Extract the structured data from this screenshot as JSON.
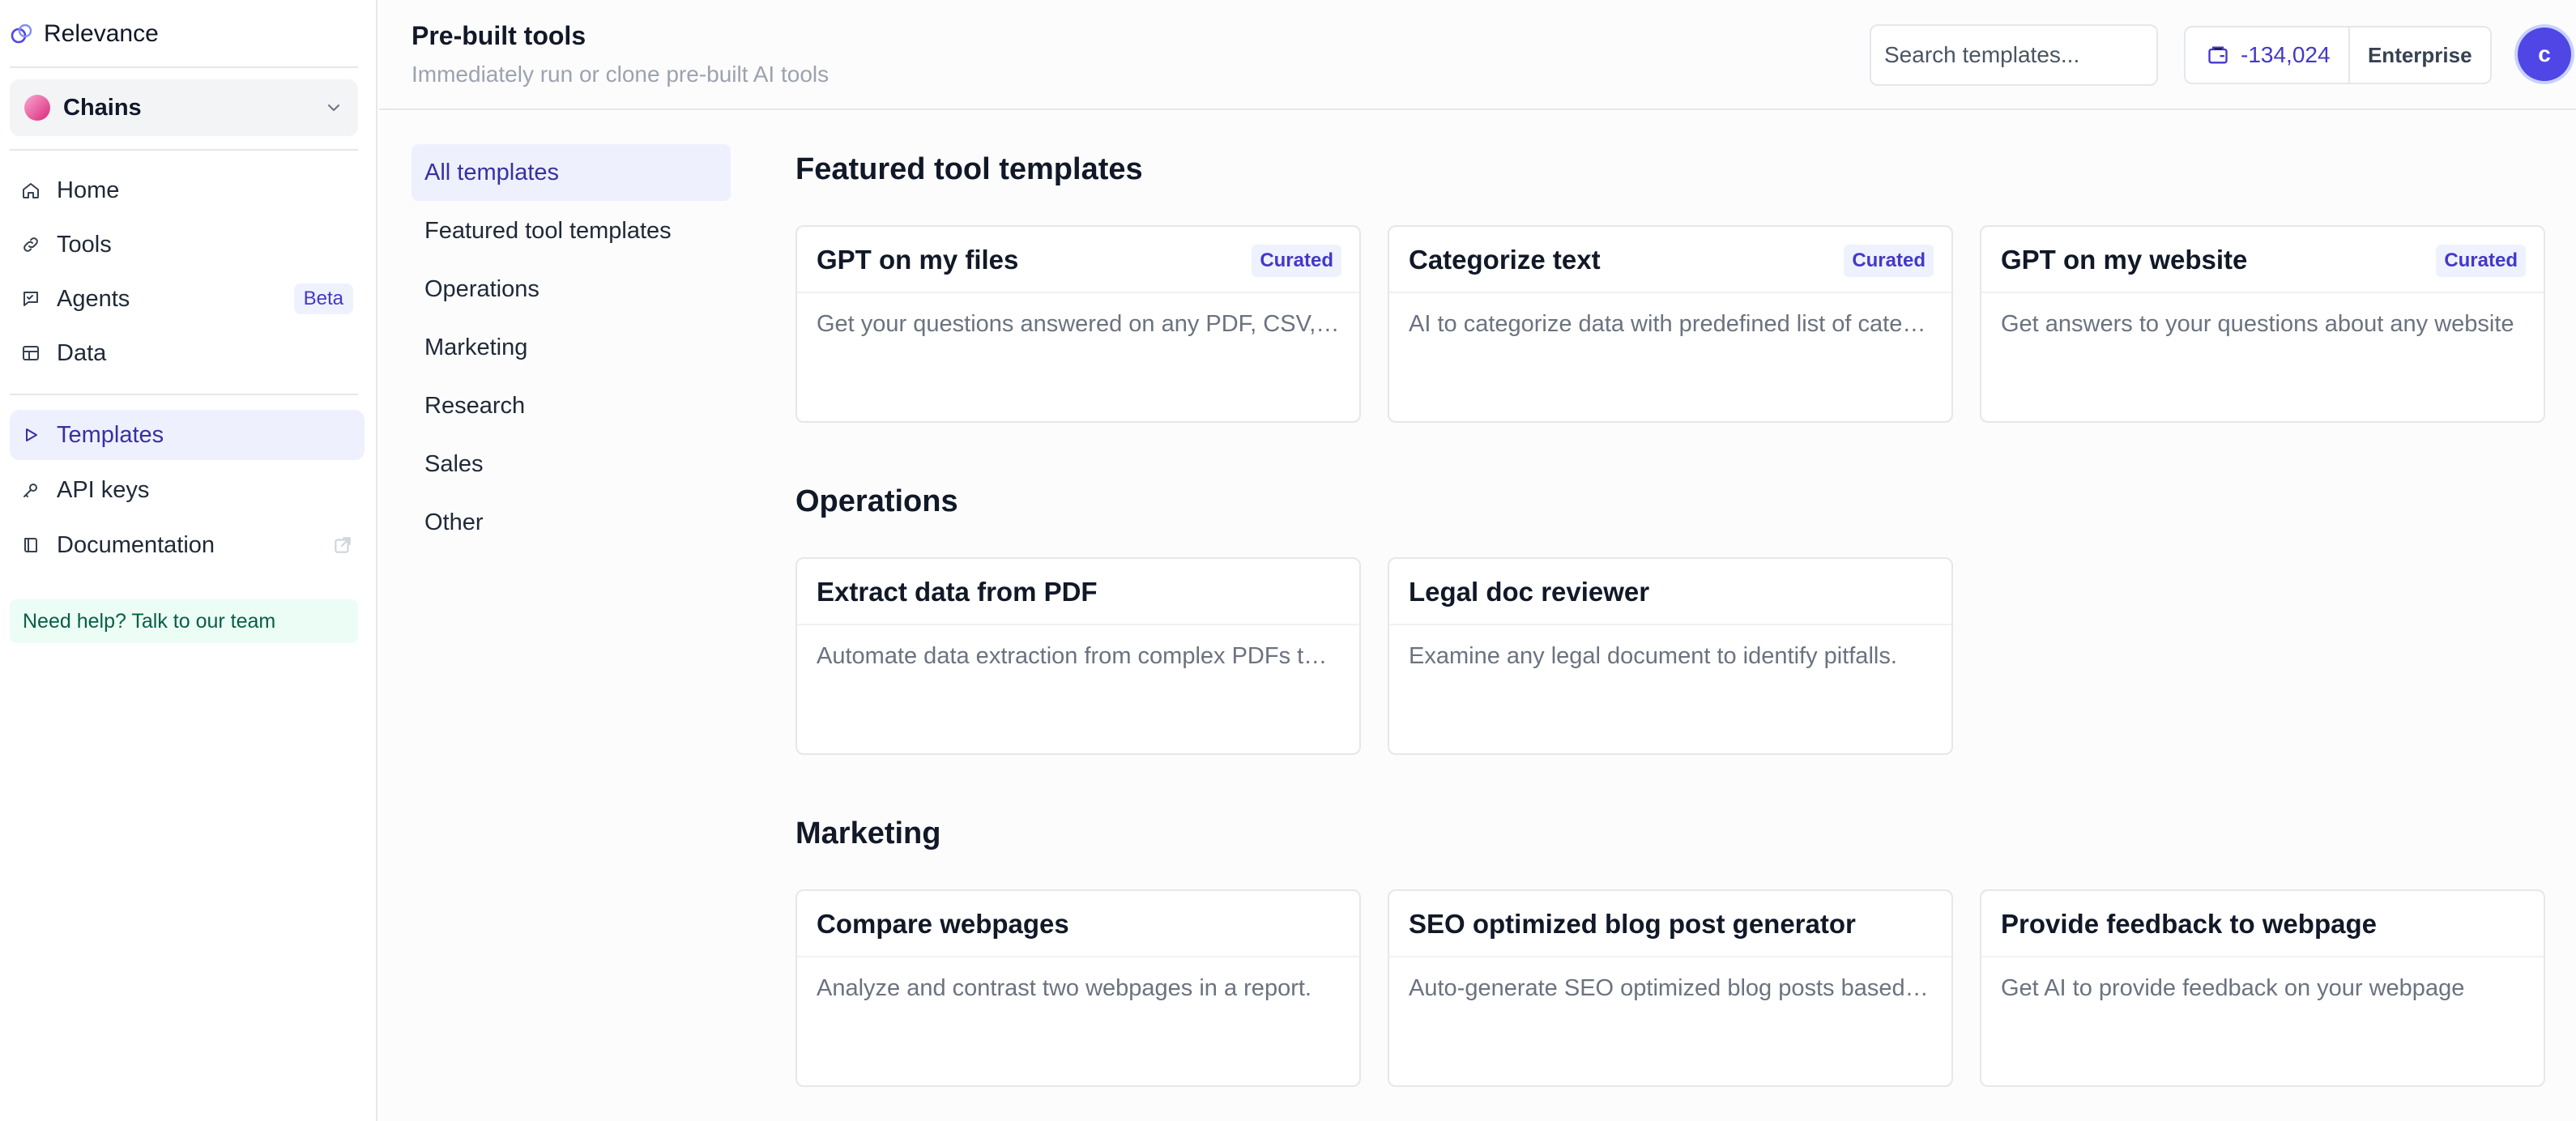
{
  "brand": {
    "name": "Relevance"
  },
  "project": {
    "name": "Chains"
  },
  "nav": {
    "home": "Home",
    "tools": "Tools",
    "agents": "Agents",
    "agents_badge": "Beta",
    "data": "Data",
    "templates": "Templates",
    "api_keys": "API keys",
    "documentation": "Documentation"
  },
  "help": {
    "label": "Need help? Talk to our team"
  },
  "header": {
    "title": "Pre-built tools",
    "subtitle": "Immediately run or clone pre-built AI tools",
    "search_placeholder": "Search templates...",
    "credits": "-134,024",
    "plan": "Enterprise",
    "avatar_initial": "c"
  },
  "categories": [
    "All templates",
    "Featured tool templates",
    "Operations",
    "Marketing",
    "Research",
    "Sales",
    "Other"
  ],
  "sections": {
    "featured": {
      "title": "Featured tool templates",
      "cards": [
        {
          "title": "GPT on my files",
          "badge": "Curated",
          "desc": "Get your questions answered on any PDF, CSV, TXT or Word doc"
        },
        {
          "title": "Categorize text",
          "badge": "Curated",
          "desc": "AI to categorize data with predefined list of categories"
        },
        {
          "title": "GPT on my website",
          "badge": "Curated",
          "desc": "Get answers to your questions about any website"
        }
      ]
    },
    "operations": {
      "title": "Operations",
      "cards": [
        {
          "title": "Extract data from PDF",
          "desc": "Automate data extraction from complex PDFs to structured data"
        },
        {
          "title": "Legal doc reviewer",
          "desc": "Examine any legal document to identify pitfalls."
        }
      ]
    },
    "marketing": {
      "title": "Marketing",
      "cards": [
        {
          "title": "Compare webpages",
          "desc": "Analyze and contrast two webpages in a report."
        },
        {
          "title": "SEO optimized blog post generator",
          "desc": "Auto-generate SEO optimized blog posts based on keywords"
        },
        {
          "title": "Provide feedback to webpage",
          "desc": "Get AI to provide feedback on your webpage"
        }
      ]
    }
  },
  "colors": {
    "accent": "#4f46e5",
    "active_bg": "#eef0fd",
    "curated_bg": "#eef2ff",
    "help_bg": "#ecfdf5"
  },
  "icons": {
    "brand": "relevance-logo-icon",
    "project_dot": "project-avatar-icon",
    "project_chevron": "chevron-down-icon",
    "home": "home-icon",
    "tools": "link-icon",
    "agents": "chat-icon",
    "data": "table-icon",
    "templates": "play-icon",
    "api_keys": "key-icon",
    "documentation": "book-icon",
    "external": "external-link-icon",
    "credits": "wallet-icon"
  }
}
